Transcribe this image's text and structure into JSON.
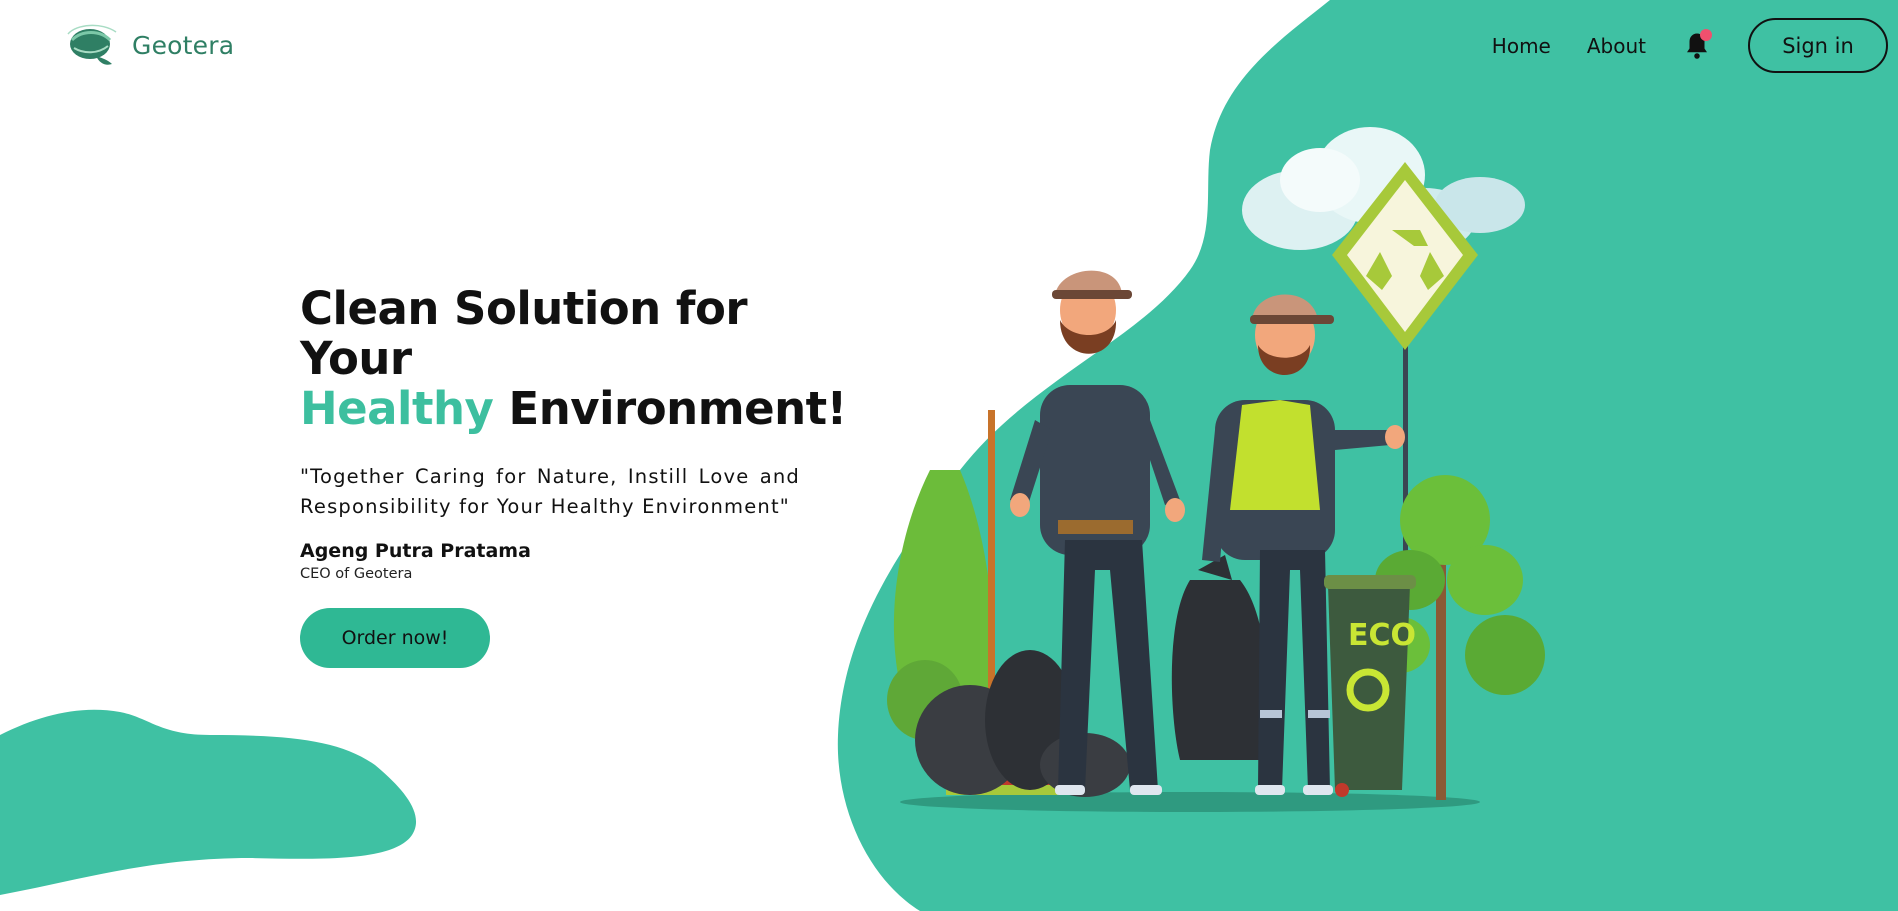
{
  "brand": {
    "name": "Geotera",
    "logo_icon": "leaf-globe-icon"
  },
  "nav": {
    "home_label": "Home",
    "about_label": "About",
    "notification_icon": "bell-icon",
    "notification_badge_color": "#f0506e",
    "signin_label": "Sign in"
  },
  "hero": {
    "title_line1": "Clean Solution for Your",
    "title_accent": "Healthy",
    "title_rest": " Environment!",
    "quote": "\"Together Caring for Nature, Instill Love and Responsibility for Your Healthy Environment\"",
    "author_name": "Ageng Putra Pratama",
    "author_role": "CEO of Geotera",
    "cta_label": "Order now!"
  },
  "illustration": {
    "eco_label": "ECO",
    "icons": [
      "recycle-sign-icon",
      "cloud-icon",
      "tree-icon",
      "trash-bag-icon",
      "eco-bin-icon",
      "broom-icon"
    ]
  },
  "colors": {
    "accent": "#3dbf9f",
    "button": "#2fb894",
    "brand_text": "#2f7f64",
    "text": "#111111"
  }
}
